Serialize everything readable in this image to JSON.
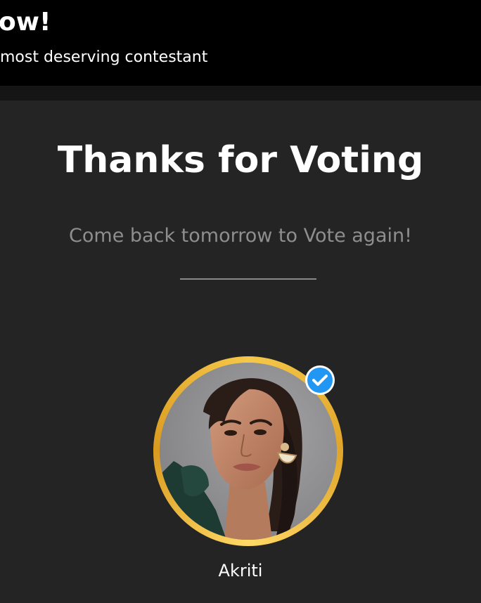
{
  "banner": {
    "title": "ow!",
    "subtitle": "most deserving contestant"
  },
  "thanks": {
    "title": "Thanks for Voting",
    "subtitle": "Come back tomorrow to Vote again!"
  },
  "contestant": {
    "name": "Akriti",
    "verified_icon": "verified-check-icon",
    "ring_color": "#f0b93a",
    "badge_color": "#2196f3"
  },
  "colors": {
    "background": "#242424",
    "banner": "#000000",
    "subtitle_text": "#8e8e8e"
  }
}
